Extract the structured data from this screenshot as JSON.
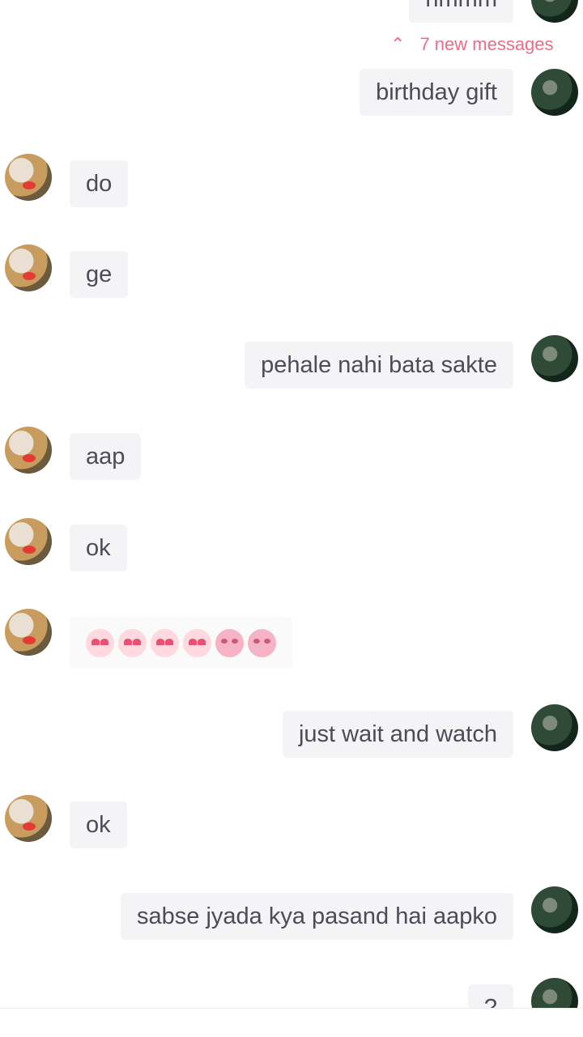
{
  "banner": {
    "new_messages": "7 new messages",
    "icon": "double-chevron-up-icon"
  },
  "messages": [
    {
      "from": "me",
      "text": "hmmm"
    },
    {
      "from": "me",
      "text": "birthday gift"
    },
    {
      "from": "them",
      "text": "do"
    },
    {
      "from": "them",
      "text": "ge"
    },
    {
      "from": "me",
      "text": "pehale nahi bata sakte"
    },
    {
      "from": "them",
      "text": "aap"
    },
    {
      "from": "them",
      "text": "ok"
    },
    {
      "from": "them",
      "emoji": [
        "heart-eyes",
        "heart-eyes",
        "heart-eyes",
        "heart-eyes",
        "kissing",
        "kissing"
      ]
    },
    {
      "from": "me",
      "text": "just wait and watch"
    },
    {
      "from": "them",
      "text": "ok"
    },
    {
      "from": "me",
      "text": "sabse jyada kya pasand hai aapko"
    },
    {
      "from": "me",
      "text": "?"
    }
  ],
  "colors": {
    "accent": "#f06b8a",
    "bubble": "#f4f4f6",
    "text": "#4a4d57"
  }
}
